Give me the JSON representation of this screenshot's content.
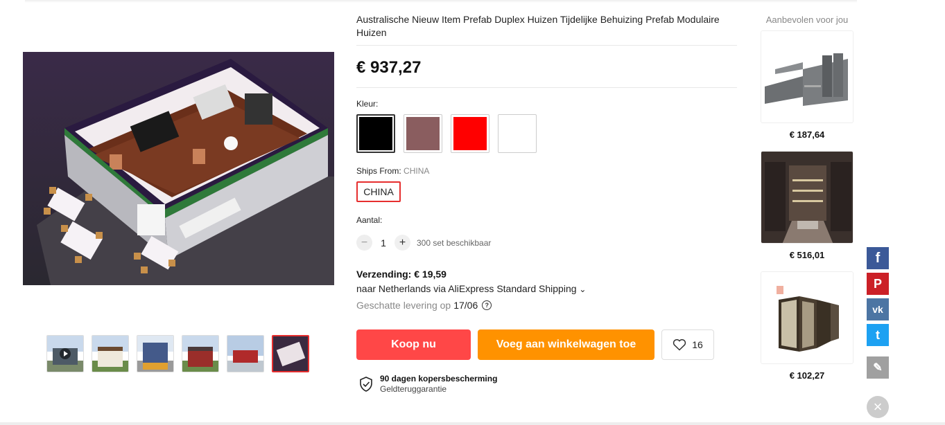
{
  "product": {
    "title": "Australische Nieuw Item Prefab Duplex Huizen Tijdelijke Behuizing Prefab Modulaire Huizen",
    "price": "€ 937,27"
  },
  "color": {
    "label": "Kleur:",
    "options": [
      "#000000",
      "#8a5d5f",
      "#ff0000",
      "#ffffff"
    ],
    "selected": 0
  },
  "shipping_from": {
    "label": "Ships From:",
    "value": "CHINA",
    "button": "CHINA"
  },
  "quantity": {
    "label": "Aantal:",
    "minus": "−",
    "value": "1",
    "plus": "+",
    "available": "300 set beschikbaar"
  },
  "shipping": {
    "cost": "Verzending: € 19,59",
    "destination": "naar Netherlands via AliExpress Standard Shipping ",
    "chevron": "⌄",
    "estimate_label": "Geschatte levering op",
    "estimate_date": "17/06",
    "help": "?"
  },
  "actions": {
    "buy": "Koop nu",
    "add_to_cart": "Voeg aan winkelwagen toe",
    "wishlist_count": "16"
  },
  "protection": {
    "title": "90 dagen kopersbescherming",
    "subtitle": "Geldteruggarantie"
  },
  "recommended": {
    "title": "Aanbevolen voor jou",
    "items": [
      {
        "price": "€ 187,64"
      },
      {
        "price": "€ 516,01"
      },
      {
        "price": "€ 102,27"
      }
    ]
  },
  "social": {
    "facebook": "f",
    "pinterest": "P",
    "vk": "vk",
    "twitter": "t",
    "edit": "✎",
    "close": "×"
  },
  "colors": {
    "buy": "#ff4747",
    "cart": "#ff9200",
    "selected_border": "#e62e2e",
    "facebook": "#3b5998",
    "pinterest": "#cb2027",
    "vk": "#4c75a3",
    "twitter": "#1da1f2",
    "edit": "#a0a0a0"
  }
}
